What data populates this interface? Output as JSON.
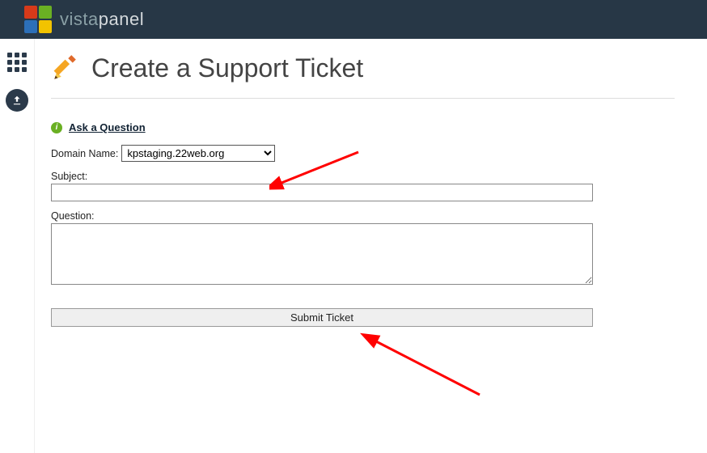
{
  "brand": {
    "part1": "vista",
    "part2": "panel"
  },
  "page": {
    "title": "Create a Support Ticket"
  },
  "form": {
    "ask_link": "Ask a Question",
    "domain_label": "Domain Name:",
    "domain_selected": "kpstaging.22web.org",
    "subject_label": "Subject:",
    "subject_value": "",
    "question_label": "Question:",
    "question_value": "",
    "submit_label": "Submit Ticket"
  }
}
